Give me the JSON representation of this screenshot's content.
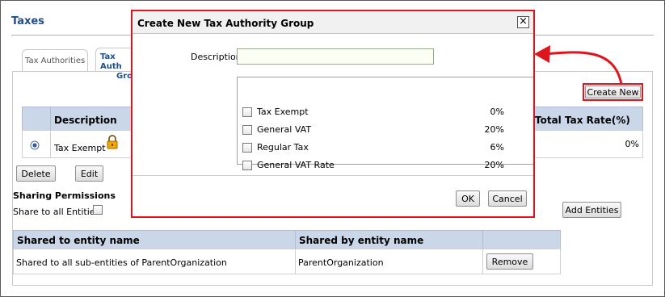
{
  "page": {
    "title": "Taxes"
  },
  "tabs": [
    {
      "label": "Tax Authorities"
    },
    {
      "label_line1": "Tax Auth",
      "label_line2": "Grou"
    }
  ],
  "toolbar": {
    "create_new_label": "Create New"
  },
  "grid": {
    "headers": {
      "description": "Description",
      "total_rate": "Total Tax Rate(%)"
    },
    "rows": [
      {
        "description": "Tax Exempt",
        "total_rate": "0%",
        "selected": true,
        "locked": true
      }
    ]
  },
  "actions": {
    "delete_label": "Delete",
    "edit_label": "Edit"
  },
  "sharing": {
    "title": "Sharing Permissions",
    "share_all_label": "Share to all Entities",
    "share_all_checked": false,
    "add_entities_label": "Add Entities",
    "headers": {
      "shared_to": "Shared to entity name",
      "shared_by": "Shared by entity name"
    },
    "rows": [
      {
        "shared_to": "Shared to all sub-entities of ParentOrganization",
        "shared_by": "ParentOrganization",
        "remove_label": "Remove"
      }
    ]
  },
  "dialog": {
    "title": "Create New Tax Authority Group",
    "close_label": "×",
    "description_label": "Description",
    "description_value": "",
    "taxes": [
      {
        "name": "Tax Exempt",
        "rate": "0%",
        "checked": false
      },
      {
        "name": "General VAT",
        "rate": "20%",
        "checked": false
      },
      {
        "name": "Regular Tax",
        "rate": "6%",
        "checked": false
      },
      {
        "name": "General VAT Rate",
        "rate": "20%",
        "checked": false
      }
    ],
    "ok_label": "OK",
    "cancel_label": "Cancel"
  },
  "colors": {
    "highlight": "#e0141d",
    "title_blue": "#1f4e8c",
    "grid_header": "#cad7e8"
  },
  "icons": {
    "lock": "lock-icon",
    "arrow": "callout-arrow-icon",
    "radio": "radio-selected-icon"
  }
}
